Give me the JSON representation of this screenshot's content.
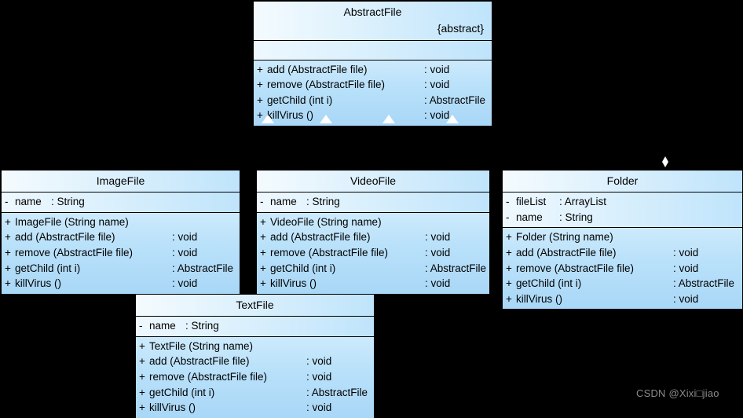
{
  "diagram": {
    "title": "AbstractFile composite pattern class diagram",
    "background_color": "#000000",
    "box_fill_color": "#bfe4fb",
    "box_border_color": "#000000",
    "connector_color": "#ffffff"
  },
  "classes": {
    "abstract_file": {
      "name": "AbstractFile",
      "stereotype": "{abstract}",
      "attributes": [],
      "operations": [
        {
          "visibility": "+",
          "signature": "add (AbstractFile file)",
          "type": ": void"
        },
        {
          "visibility": "+",
          "signature": "remove (AbstractFile file)",
          "type": ": void"
        },
        {
          "visibility": "+",
          "signature": "getChild (int i)",
          "type": ": AbstractFile"
        },
        {
          "visibility": "+",
          "signature": "killVirus ()",
          "type": ": void"
        }
      ]
    },
    "image_file": {
      "name": "ImageFile",
      "attributes": [
        {
          "visibility": "-",
          "signature": "name",
          "type": ": String"
        }
      ],
      "operations": [
        {
          "visibility": "+",
          "signature": "ImageFile (String name)",
          "type": ""
        },
        {
          "visibility": "+",
          "signature": "add (AbstractFile file)",
          "type": ": void"
        },
        {
          "visibility": "+",
          "signature": "remove (AbstractFile file)",
          "type": ": void"
        },
        {
          "visibility": "+",
          "signature": "getChild (int i)",
          "type": ": AbstractFile"
        },
        {
          "visibility": "+",
          "signature": "killVirus ()",
          "type": ": void"
        }
      ]
    },
    "video_file": {
      "name": "VideoFile",
      "attributes": [
        {
          "visibility": "-",
          "signature": "name",
          "type": ": String"
        }
      ],
      "operations": [
        {
          "visibility": "+",
          "signature": "VideoFile (String name)",
          "type": ""
        },
        {
          "visibility": "+",
          "signature": "add (AbstractFile file)",
          "type": ": void"
        },
        {
          "visibility": "+",
          "signature": "remove (AbstractFile file)",
          "type": ": void"
        },
        {
          "visibility": "+",
          "signature": "getChild (int i)",
          "type": ": AbstractFile"
        },
        {
          "visibility": "+",
          "signature": "killVirus ()",
          "type": ": void"
        }
      ]
    },
    "folder": {
      "name": "Folder",
      "attributes": [
        {
          "visibility": "-",
          "signature": "fileList",
          "type": ": ArrayList"
        },
        {
          "visibility": "-",
          "signature": "name",
          "type": ": String"
        }
      ],
      "operations": [
        {
          "visibility": "+",
          "signature": "Folder (String name)",
          "type": ""
        },
        {
          "visibility": "+",
          "signature": "add (AbstractFile file)",
          "type": ": void"
        },
        {
          "visibility": "+",
          "signature": "remove (AbstractFile file)",
          "type": ": void"
        },
        {
          "visibility": "+",
          "signature": "getChild (int i)",
          "type": ": AbstractFile"
        },
        {
          "visibility": "+",
          "signature": "killVirus ()",
          "type": ": void"
        }
      ]
    },
    "text_file": {
      "name": "TextFile",
      "attributes": [
        {
          "visibility": "-",
          "signature": "name",
          "type": ": String"
        }
      ],
      "operations": [
        {
          "visibility": "+",
          "signature": "TextFile (String name)",
          "type": ""
        },
        {
          "visibility": "+",
          "signature": "add (AbstractFile file)",
          "type": ": void"
        },
        {
          "visibility": "+",
          "signature": "remove (AbstractFile file)",
          "type": ": void"
        },
        {
          "visibility": "+",
          "signature": "getChild (int i)",
          "type": ": AbstractFile"
        },
        {
          "visibility": "+",
          "signature": "killVirus ()",
          "type": ": void"
        }
      ]
    }
  },
  "connectors": {
    "generalization_arrows": [
      {
        "name": "generalization-arrow-1"
      },
      {
        "name": "generalization-arrow-2"
      },
      {
        "name": "generalization-arrow-3"
      },
      {
        "name": "generalization-arrow-4"
      }
    ],
    "aggregation_diamond": {
      "name": "aggregation-diamond"
    }
  },
  "watermark": {
    "text": "CSDN @Xixi□jiao"
  }
}
